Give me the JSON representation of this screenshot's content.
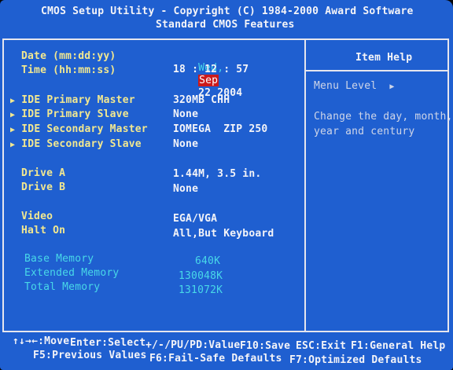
{
  "header": {
    "line1": "CMOS Setup Utility - Copyright (C) 1984-2000 Award Software",
    "line2": "Standard CMOS Features"
  },
  "fields": {
    "date_label": "Date (mm:dd:yy)",
    "date_day": "Wed,",
    "date_month": "Sep",
    "date_rest": "22 2004",
    "time_label": "Time (hh:mm:ss)",
    "time_value": "18 : 12 : 57",
    "ide_primary_master_label": "IDE Primary Master",
    "ide_primary_master_value": "320MB CHH",
    "ide_primary_slave_label": "IDE Primary Slave",
    "ide_primary_slave_value": "None",
    "ide_secondary_master_label": "IDE Secondary Master",
    "ide_secondary_master_value": "IOMEGA  ZIP 250",
    "ide_secondary_slave_label": "IDE Secondary Slave",
    "ide_secondary_slave_value": "None",
    "drive_a_label": "Drive A",
    "drive_a_value": "1.44M, 3.5 in.",
    "drive_b_label": "Drive B",
    "drive_b_value": "None",
    "video_label": "Video",
    "video_value": "EGA/VGA",
    "halt_on_label": "Halt On",
    "halt_on_value": "All,But Keyboard",
    "base_memory_label": "Base Memory",
    "base_memory_value": "640K",
    "extended_memory_label": "Extended Memory",
    "extended_memory_value": "130048K",
    "total_memory_label": "Total Memory",
    "total_memory_value": "131072K"
  },
  "help_panel": {
    "title": "Item Help",
    "menu_level": "Menu Level",
    "text_line1": "Change the day, month,",
    "text_line2": "year and century"
  },
  "footer": {
    "move": "↑↓→←:Move",
    "enter": "Enter:Select",
    "value": "+/-/PU/PD:Value",
    "f10": "F10:Save",
    "esc": "ESC:Exit",
    "f1": "F1:General Help",
    "f5": "F5:Previous Values",
    "f6": "F6:Fail-Safe Defaults",
    "f7": "F7:Optimized Defaults"
  },
  "submenu_arrow": "▶",
  "colors": {
    "background": "#1f5fd0",
    "highlight": "#cc1a1a",
    "label_yellow": "#f2e890",
    "value_white": "#f4f4f8",
    "memory_cyan": "#48d8e8"
  }
}
